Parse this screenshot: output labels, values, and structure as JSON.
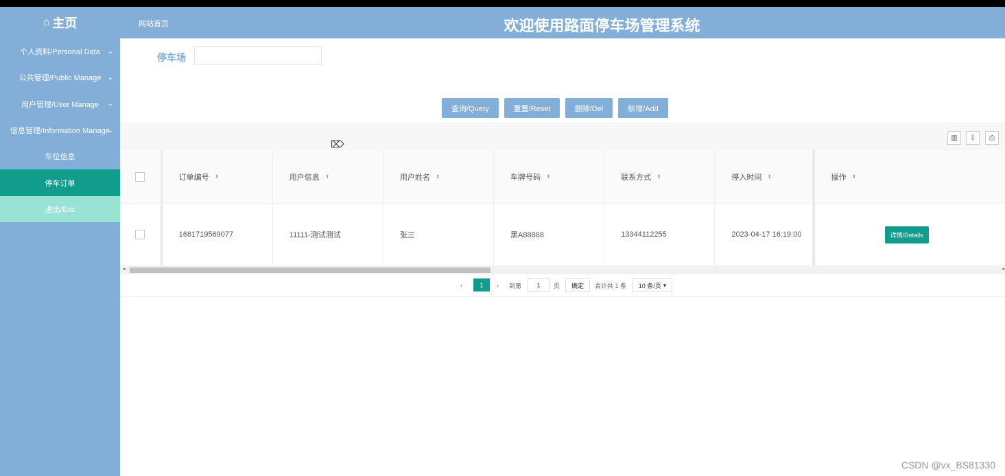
{
  "header": {
    "brand_icon": "home-icon",
    "brand": "主页",
    "site_home": "网站首页",
    "title": "欢迎使用路面停车场管理系统"
  },
  "sidebar": {
    "items": [
      {
        "label": "个人资料/Personal Data"
      },
      {
        "label": "公共管理/Public Manage"
      },
      {
        "label": "用户管理/User Manage"
      },
      {
        "label": "信息管理/Information Manage"
      },
      {
        "label": "车位信息"
      },
      {
        "label": "停车订单"
      },
      {
        "label": "退出/Exit"
      }
    ]
  },
  "search": {
    "label": "停车场",
    "value": ""
  },
  "buttons": {
    "query": "查询/Query",
    "reset": "重置/Reset",
    "delete": "删除/Del",
    "add": "新增/Add"
  },
  "table": {
    "columns": [
      "订单编号",
      "用户信息",
      "用户姓名",
      "车牌号码",
      "联系方式",
      "停入时间",
      "操作"
    ],
    "rows": [
      {
        "order_no": "1681719569077",
        "user_info": "11111-测试测试",
        "user_name": "张三",
        "plate": "黑A88888",
        "contact": "13344112255",
        "time": "2023-04-17 16:19:00",
        "action": "详情/Details"
      }
    ]
  },
  "pager": {
    "current": "1",
    "goto_label": "到第",
    "goto_value": "1",
    "page_unit": "页",
    "confirm": "确定",
    "total": "合计共 1 条",
    "per_page": "10 条/页"
  },
  "watermark": "CSDN @vx_BS81330",
  "colors": {
    "header": "#82aed8",
    "active": "#119c8c",
    "exit": "#98e3d3"
  }
}
